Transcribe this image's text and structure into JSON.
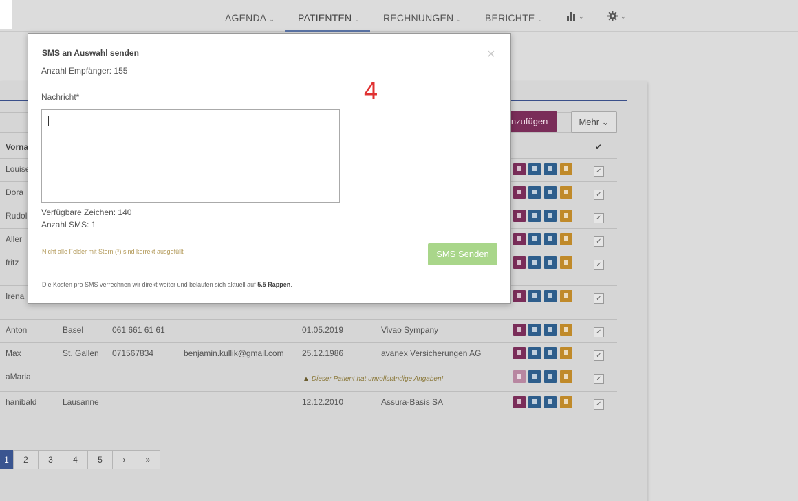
{
  "nav": {
    "items": [
      {
        "label": "AGENDA",
        "chev": "⌄"
      },
      {
        "label": "PATIENTEN",
        "chev": "⌄"
      },
      {
        "label": "RECHNUNGEN",
        "chev": "⌄"
      },
      {
        "label": "BERICHTE",
        "chev": "⌄"
      }
    ],
    "chart_chev": "⌄",
    "settings_chev": "⌄"
  },
  "toolbar": {
    "add_label": "inzufügen",
    "more_label": "Mehr ⌄"
  },
  "table": {
    "header_firstname": "Vorna",
    "header_check": "✔",
    "rows": [
      {
        "first": "Louise"
      },
      {
        "first": "Dora"
      },
      {
        "first": "Rudol"
      },
      {
        "first": "Aller"
      },
      {
        "first": "fritz"
      },
      {
        "first": "Irena"
      },
      {
        "first": "Anton",
        "city": "Basel",
        "phone": "061 661 61 61",
        "email": "",
        "dob": "01.05.2019",
        "insurer": "Vivao Sympany"
      },
      {
        "first": "Max",
        "city": "St. Gallen",
        "phone": "071567834",
        "email": "benjamin.kullik@gmail.com",
        "dob": "25.12.1986",
        "insurer": "avanex Versicherungen AG"
      },
      {
        "first": "aMaria",
        "warning": "Dieser Patient hat unvollständige Angaben!"
      },
      {
        "first": "hanibald",
        "city": "Lausanne",
        "dob": "12.12.2010",
        "insurer": "Assura-Basis SA"
      }
    ]
  },
  "pagination": {
    "pages": [
      "1",
      "2",
      "3",
      "4",
      "5"
    ],
    "next": "›",
    "last": "»"
  },
  "modal": {
    "title": "SMS an Auswahl senden",
    "close": "×",
    "recipients": "Anzahl Empfänger: 155",
    "annotation": "4",
    "message_label": "Nachricht*",
    "message_value": "",
    "chars_available": "Verfügbare Zeichen: 140",
    "sms_count": "Anzahl SMS: 1",
    "hint": "Nicht alle Felder mit Stern (*) sind korrekt ausgefüllt",
    "send_label": "SMS Senden",
    "footer_prefix": "Die Kosten pro SMS verrechnen wir direkt weiter und belaufen sich aktuell auf",
    "footer_price": "5.5 Rappen",
    "footer_suffix": "."
  },
  "colors": {
    "accent_blue": "#5b74a6",
    "send_button": "#a9d68a",
    "action_doc": "#7a2d59",
    "action_list": "#2e5e8c",
    "action_delete": "#c08a2a",
    "annotation_red": "#e03232"
  }
}
